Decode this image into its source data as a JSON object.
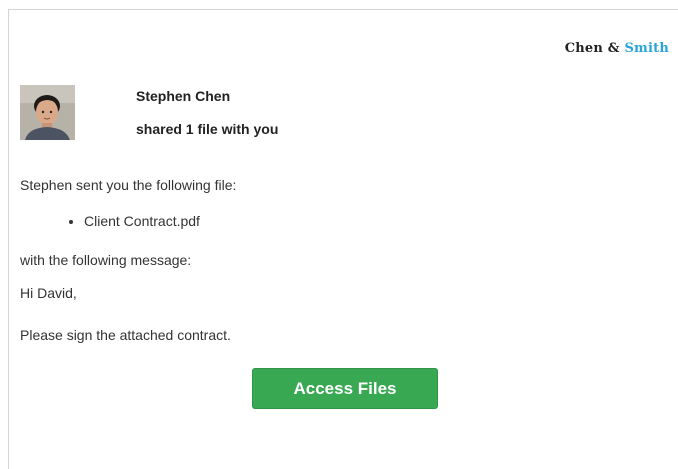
{
  "brand": {
    "name_part1": "Chen",
    "ampersand": "&",
    "name_part2": "Smith",
    "accent_color": "#2aa3d8"
  },
  "sender": {
    "name": "Stephen Chen",
    "action": "shared 1 file with you",
    "avatar_icon": "user-photo"
  },
  "email": {
    "intro": "Stephen sent you the following file:",
    "files": [
      "Client Contract.pdf"
    ],
    "message_label": "with the following message:",
    "greeting": "Hi David,",
    "body": "Please sign the attached contract."
  },
  "cta": {
    "label": "Access Files",
    "color": "#38a853"
  }
}
